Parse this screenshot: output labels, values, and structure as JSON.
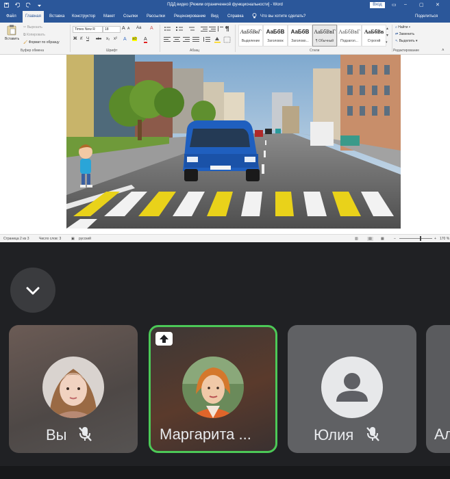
{
  "word": {
    "window_title": "ПДД видео [Режим ограниченной функциональности] - Word",
    "login_button": "Вход",
    "tabs": [
      "Файл",
      "Главная",
      "Вставка",
      "Конструктор",
      "Макет",
      "Ссылки",
      "Рассылки",
      "Рецензирование",
      "Вид",
      "Справка"
    ],
    "tell_me": "Что вы хотите сделать?",
    "share": "Поделиться",
    "clipboard": {
      "paste": "Вставить",
      "cut": "Вырезать",
      "copy": "Копировать",
      "format_painter": "Формат по образцу",
      "label": "Буфер обмена"
    },
    "font": {
      "name": "Times New R",
      "size": "18",
      "label": "Шрифт",
      "bold": "Ж",
      "italic": "К",
      "underline": "Ч",
      "strike": "abc",
      "subscript": "x₂",
      "superscript": "x²",
      "grow": "A",
      "shrink": "A",
      "case": "Aa",
      "clear": "A",
      "text_effects": "A",
      "highlight": "ab",
      "font_color": "A"
    },
    "paragraph": {
      "label": "Абзац"
    },
    "styles": {
      "label": "Стили",
      "items": [
        {
          "sample": "АаБбВвГ",
          "name": "Выделение"
        },
        {
          "sample": "АаБбВ",
          "name": "Заголовок"
        },
        {
          "sample": "АаБбВ",
          "name": "Заголово..."
        },
        {
          "sample": "АаБбВвГ",
          "name": "¶ Обычный"
        },
        {
          "sample": "АаБбВвГ",
          "name": "Подзагол..."
        },
        {
          "sample": "АаБбВв",
          "name": "Строгий"
        }
      ]
    },
    "editing": {
      "label": "Редактирование",
      "find": "Найти",
      "replace": "Заменить",
      "select": "Выделить"
    },
    "status": {
      "page": "Страница 2 из 3",
      "words": "Число слов: 3",
      "language": "русский",
      "zoom": "170 %",
      "zoom_fraction": 0.62
    }
  },
  "call": {
    "participants": [
      {
        "name": "Вы",
        "muted": true,
        "active_speaker": false,
        "presenting": false
      },
      {
        "name": "Маргарита ...",
        "muted": false,
        "active_speaker": true,
        "presenting": true
      },
      {
        "name": "Юлия",
        "muted": true,
        "active_speaker": false,
        "presenting": false
      },
      {
        "name": "Ал",
        "muted": false,
        "active_speaker": false,
        "presenting": false
      }
    ],
    "accent_color": "#4cc957"
  }
}
